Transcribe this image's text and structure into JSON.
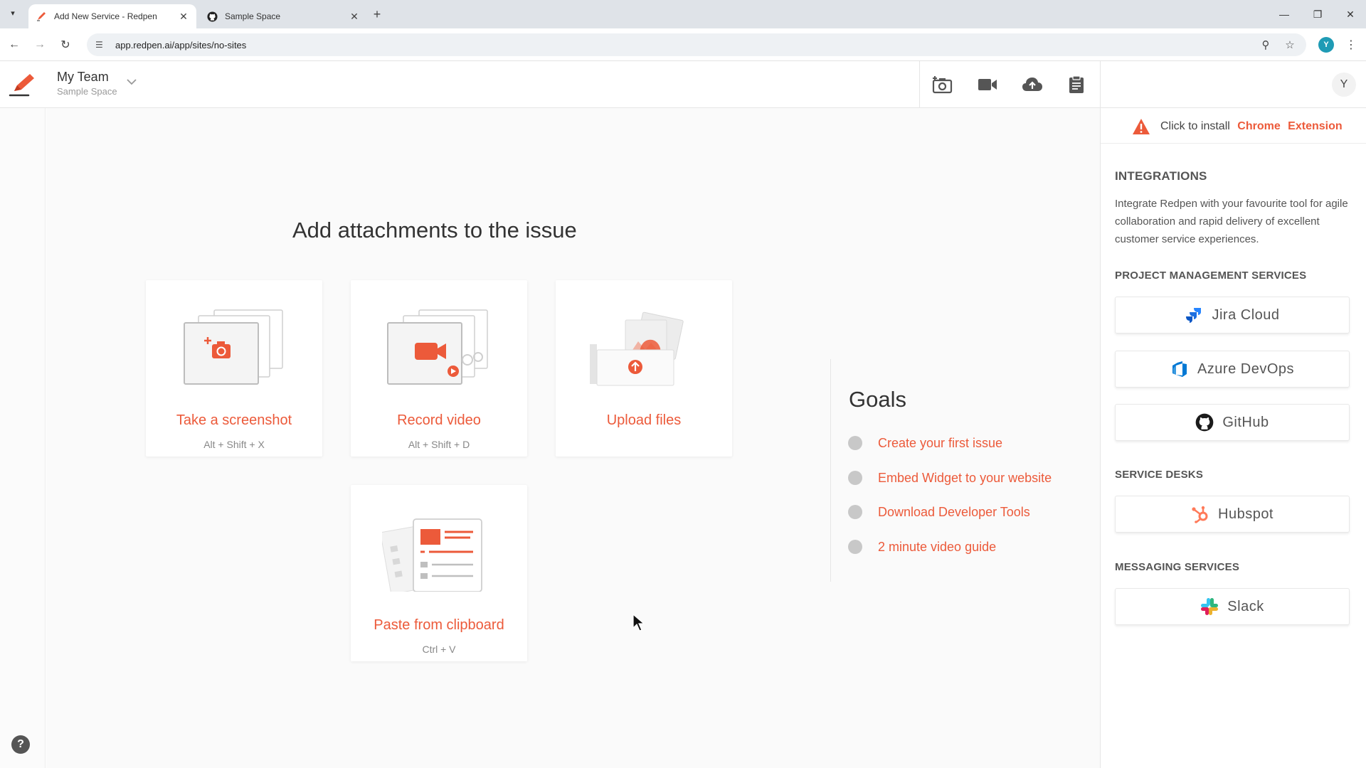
{
  "browser": {
    "tabs": [
      {
        "title": "Add New Service - Redpen",
        "icon": "redpen-pen-icon",
        "active": true
      },
      {
        "title": "Sample Space",
        "icon": "github-icon",
        "active": false
      }
    ],
    "url": "app.redpen.ai/app/sites/no-sites",
    "profile_initial": "Y"
  },
  "header": {
    "team_name": "My Team",
    "space_name": "Sample Space",
    "user_initial": "Y",
    "tools": [
      "camera-plus-icon",
      "video-camera-icon",
      "cloud-upload-icon",
      "clipboard-icon"
    ]
  },
  "main": {
    "title": "Add attachments to the issue",
    "cards": [
      {
        "title": "Take a screenshot",
        "shortcut": "Alt + Shift + X",
        "icon": "screenshot-illustration"
      },
      {
        "title": "Record video",
        "shortcut": "Alt + Shift + D",
        "icon": "video-illustration"
      },
      {
        "title": "Upload files",
        "shortcut": "",
        "icon": "upload-illustration"
      },
      {
        "title": "Paste from clipboard",
        "shortcut": "Ctrl + V",
        "icon": "clipboard-illustration"
      }
    ],
    "goals": {
      "title": "Goals",
      "items": [
        "Create your first issue",
        "Embed Widget to your website",
        "Download Developer Tools",
        "2 minute video guide"
      ]
    }
  },
  "right_panel": {
    "extension": {
      "prefix": "Click to install",
      "link1": "Chrome",
      "link2": "Extension"
    },
    "integrations": {
      "heading": "INTEGRATIONS",
      "description": "Integrate Redpen with your favourite tool for agile collaboration and rapid delivery of excellent customer service experiences."
    },
    "project_management": {
      "heading": "PROJECT MANAGEMENT SERVICES",
      "services": [
        "Jira Cloud",
        "Azure DevOps",
        "GitHub"
      ]
    },
    "service_desks": {
      "heading": "SERVICE DESKS",
      "services": [
        "Hubspot"
      ]
    },
    "messaging": {
      "heading": "MESSAGING SERVICES",
      "services": [
        "Slack"
      ]
    }
  },
  "colors": {
    "accent": "#ec5a3a",
    "jira": "#2684ff",
    "azure": "#0078d4",
    "hubspot": "#ff7a59"
  }
}
